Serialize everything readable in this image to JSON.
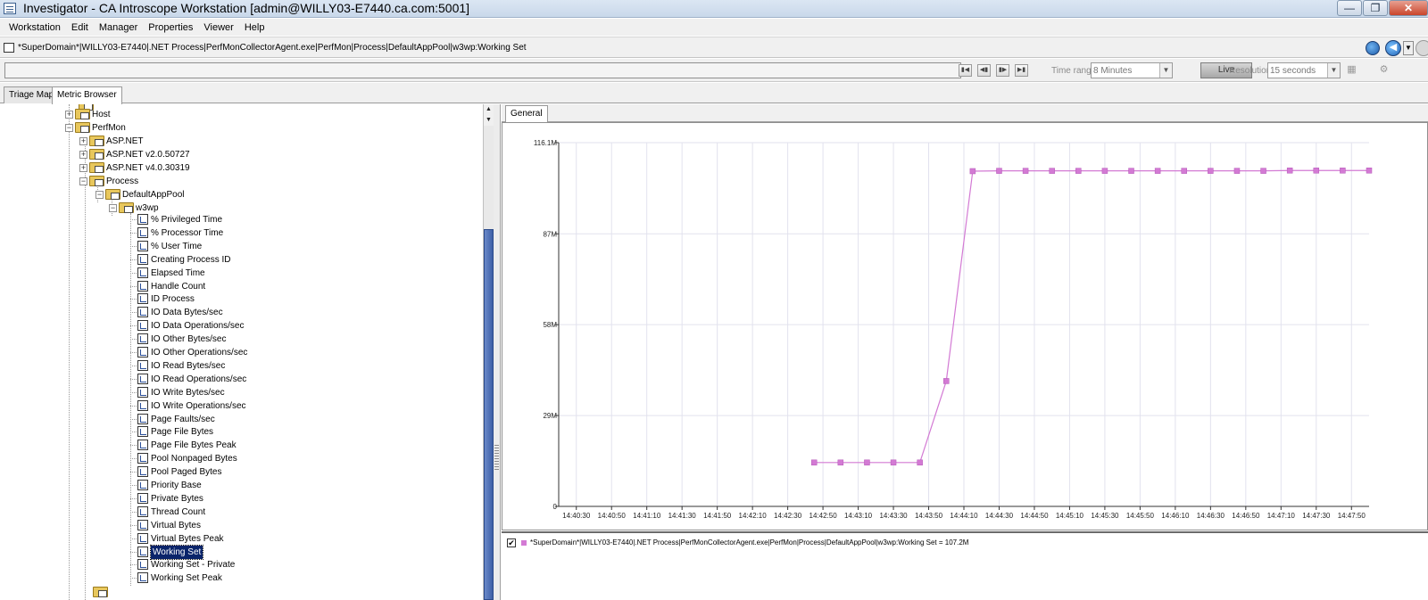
{
  "window": {
    "title": "Investigator - CA Introscope Workstation [admin@WILLY03-E7440.ca.com:5001]",
    "minimize": "—",
    "restore": "❐",
    "close": "✕"
  },
  "menu": [
    "Workstation",
    "Edit",
    "Manager",
    "Properties",
    "Viewer",
    "Help"
  ],
  "path": "*SuperDomain*|WILLY03-E7440|.NET Process|PerfMonCollectorAgent.exe|PerfMon|Process|DefaultAppPool|w3wp:Working Set",
  "toolbar": {
    "time_range_label": "Time range",
    "time_range_value": "8 Minutes",
    "live_label": "Live",
    "resolution_label": "Resolution",
    "resolution_value": "15 seconds"
  },
  "tabs": [
    {
      "label": "Triage Map",
      "active": false
    },
    {
      "label": "Metric Browser",
      "active": true
    }
  ],
  "tree": {
    "partial_top": "",
    "nodes": [
      {
        "label": "Host",
        "level": 0,
        "type": "folder",
        "expander": "+"
      },
      {
        "label": "PerfMon",
        "level": 0,
        "type": "folder",
        "expander": "−"
      },
      {
        "label": "ASP.NET",
        "level": 1,
        "type": "folder",
        "expander": "+"
      },
      {
        "label": "ASP.NET v2.0.50727",
        "level": 1,
        "type": "folder",
        "expander": "+"
      },
      {
        "label": "ASP.NET v4.0.30319",
        "level": 1,
        "type": "folder",
        "expander": "+"
      },
      {
        "label": "Process",
        "level": 1,
        "type": "folder",
        "expander": "−"
      },
      {
        "label": "DefaultAppPool",
        "level": 2,
        "type": "folder",
        "expander": "−"
      },
      {
        "label": "w3wp",
        "level": 3,
        "type": "folder",
        "expander": "−"
      }
    ],
    "metrics": [
      "% Privileged Time",
      "% Processor Time",
      "% User Time",
      "Creating Process ID",
      "Elapsed Time",
      "Handle Count",
      "ID Process",
      "IO Data Bytes/sec",
      "IO Data Operations/sec",
      "IO Other Bytes/sec",
      "IO Other Operations/sec",
      "IO Read Bytes/sec",
      "IO Read Operations/sec",
      "IO Write Bytes/sec",
      "IO Write Operations/sec",
      "Page Faults/sec",
      "Page File Bytes",
      "Page File Bytes Peak",
      "Pool Nonpaged Bytes",
      "Pool Paged Bytes",
      "Priority Base",
      "Private Bytes",
      "Thread Count",
      "Virtual Bytes",
      "Virtual Bytes Peak",
      "Working Set",
      "Working Set - Private",
      "Working Set Peak"
    ],
    "selected": "Working Set"
  },
  "right_tab": "General",
  "colors": {
    "series": "#d37ad4",
    "selection": "#0a246a",
    "scroll_thumb": "#4a6bb0"
  },
  "legend": {
    "checked": "✔",
    "text": "*SuperDomain*|WILLY03-E7440|.NET Process|PerfMonCollectorAgent.exe|PerfMon|Process|DefaultAppPool|w3wp:Working Set = 107.2M"
  },
  "chart_data": {
    "type": "line",
    "title": "",
    "xlabel": "",
    "ylabel": "",
    "y_ticks": [
      "116.1M",
      "87M",
      "58M",
      "29M",
      "0"
    ],
    "y_tick_values": [
      116.1,
      87,
      58,
      29,
      0
    ],
    "ylim": [
      0,
      116.1
    ],
    "x_ticks": [
      "14:40:30",
      "14:40:50",
      "14:41:10",
      "14:41:30",
      "14:41:50",
      "14:42:10",
      "14:42:30",
      "14:42:50",
      "14:43:10",
      "14:43:30",
      "14:43:50",
      "14:44:10",
      "14:44:30",
      "14:44:50",
      "14:45:10",
      "14:45:30",
      "14:45:50",
      "14:46:10",
      "14:46:30",
      "14:46:50",
      "14:47:10",
      "14:47:30",
      "14:47:50"
    ],
    "xlim": [
      "14:40:20",
      "14:48:00"
    ],
    "grid": true,
    "legend": "bottom",
    "series": [
      {
        "name": "*SuperDomain*|WILLY03-E7440|.NET Process|PerfMonCollectorAgent.exe|PerfMon|Process|DefaultAppPool|w3wp:Working Set",
        "x": [
          "14:42:45",
          "14:43:00",
          "14:43:15",
          "14:43:30",
          "14:43:45",
          "14:44:00",
          "14:44:15",
          "14:44:30",
          "14:44:45",
          "14:45:00",
          "14:45:15",
          "14:45:30",
          "14:45:45",
          "14:46:00",
          "14:46:15",
          "14:46:30",
          "14:46:45",
          "14:47:00",
          "14:47:15",
          "14:47:30",
          "14:47:45",
          "14:48:00"
        ],
        "values": [
          14,
          14,
          14,
          14,
          14,
          40,
          107.0,
          107.1,
          107.1,
          107.1,
          107.1,
          107.1,
          107.1,
          107.1,
          107.1,
          107.1,
          107.1,
          107.1,
          107.2,
          107.2,
          107.2,
          107.2
        ]
      }
    ]
  }
}
